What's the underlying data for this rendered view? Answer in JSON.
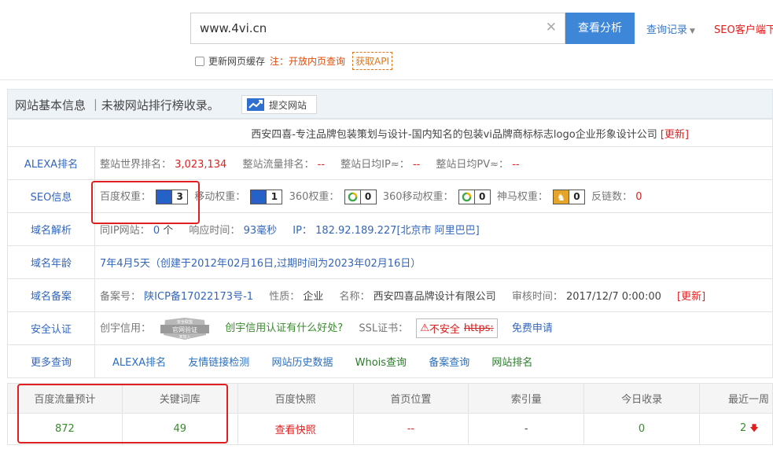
{
  "search": {
    "value": "www.4vi.cn",
    "clear_icon": "close-icon",
    "button_label": "查看分析",
    "history_label": "查询记录",
    "client_label": "SEO客户端下"
  },
  "options": {
    "cache_label": "更新网页缓存",
    "note": "注：开放内页查询",
    "api_label": "获取API"
  },
  "panel": {
    "title": "网站基本信息 ｜未被网站排行榜收录。",
    "submit_label": "提交网站"
  },
  "site": {
    "title": "西安四喜-专注品牌包装策划与设计-国内知名的包装vi品牌商标标志logo企业形象设计公司",
    "update_label": "[更新]"
  },
  "alexa": {
    "label": "ALEXA排名",
    "world_rank_label": "整站世界排名：",
    "world_rank": "3,023,134",
    "traffic_rank_label": "整站流量排名：",
    "traffic_rank": "--",
    "daily_ip_label": "整站日均IP≈：",
    "daily_ip": "--",
    "daily_pv_label": "整站日均PV≈：",
    "daily_pv": "--"
  },
  "seo": {
    "label": "SEO信息",
    "baidu_label": "百度权重：",
    "baidu_value": "3",
    "mobile_label": "移动权重：",
    "mobile_value": "1",
    "s360_label": "360权重：",
    "s360_value": "0",
    "s360m_label": "360移动权重：",
    "s360m_value": "0",
    "shenma_label": "神马权重：",
    "shenma_value": "0",
    "backlinks_label": "反链数：",
    "backlinks_value": "0"
  },
  "dns": {
    "label": "域名解析",
    "same_ip_label": "同IP网站：",
    "same_ip_value": "0",
    "same_ip_unit": "个",
    "response_label": "响应时间：",
    "response_value": "93毫秒",
    "ip_label": "IP：",
    "ip_value": "182.92.189.227[北京市 阿里巴巴]"
  },
  "age": {
    "label": "域名年龄",
    "value": "7年4月5天（创建于2012年02月16日,过期时间为2023年02月16日）"
  },
  "icp": {
    "label": "域名备案",
    "no_label": "备案号：",
    "no_value": "陕ICP备17022173号-1",
    "type_label": "性质：",
    "type_value": "企业",
    "name_label": "名称：",
    "name_value": "西安四喜品牌设计有限公司",
    "time_label": "审核时间：",
    "time_value": "2017/12/7 0:00:00",
    "update_label": "[更新]"
  },
  "security": {
    "label": "安全认证",
    "credit_label": "创宇信用：",
    "badge_top": "安全联盟",
    "badge_main": "官网验证",
    "badge_sub": "未加入",
    "credit_link": "创宇信用认证有什么好处?",
    "ssl_label": "SSL证书：",
    "unsafe_label": "不安全",
    "https_label": "https:",
    "free_apply": "免费申请"
  },
  "more": {
    "label": "更多查询",
    "links": [
      "ALEXA排名",
      "友情链接检测",
      "网站历史数据",
      "Whois查询",
      "备案查询",
      "网站排名"
    ]
  },
  "stats": {
    "headers": [
      "百度流量预计",
      "关键词库",
      "百度快照",
      "首页位置",
      "索引量",
      "今日收录",
      "最近一周"
    ],
    "values": [
      "872",
      "49",
      "查看快照",
      "--",
      "-",
      "0",
      "2"
    ],
    "trend_icon": "down-arrow-icon"
  },
  "colors": {
    "accent": "#3e86d8",
    "highlight_box": "#e02020"
  }
}
